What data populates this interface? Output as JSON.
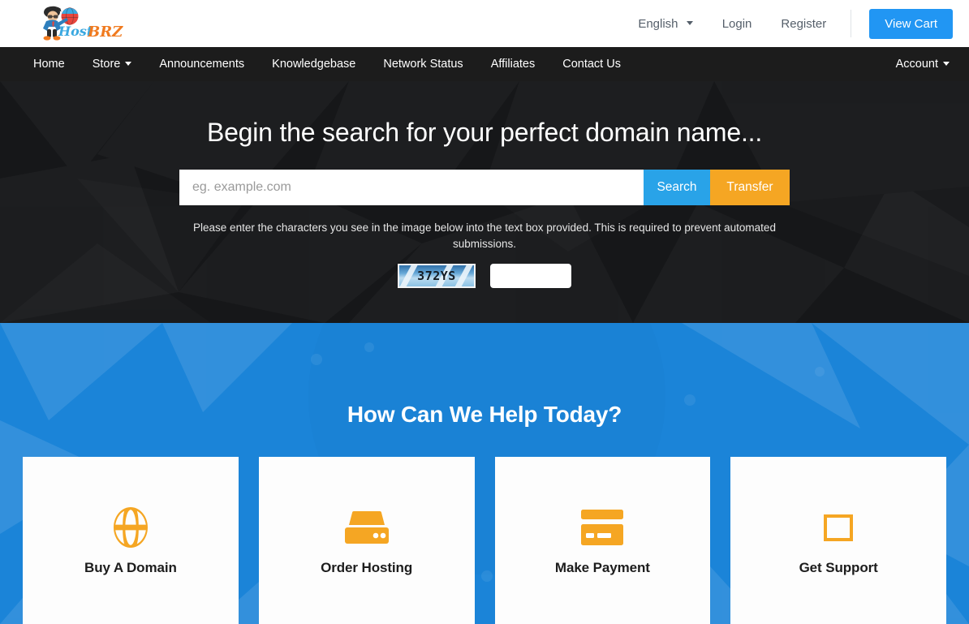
{
  "header": {
    "logo": {
      "name": "HostBRZ",
      "word1": "Host",
      "word2": "BRZ",
      "color1": "#3aa8e0",
      "color2": "#f07a1f"
    },
    "language": "English",
    "login": "Login",
    "register": "Register",
    "view_cart": "View Cart",
    "cart_color": "#2196f3"
  },
  "nav": {
    "items": [
      {
        "label": "Home",
        "caret": false
      },
      {
        "label": "Store",
        "caret": true
      },
      {
        "label": "Announcements",
        "caret": false
      },
      {
        "label": "Knowledgebase",
        "caret": false
      },
      {
        "label": "Network Status",
        "caret": false
      },
      {
        "label": "Affiliates",
        "caret": false
      },
      {
        "label": "Contact Us",
        "caret": false
      }
    ],
    "account": "Account",
    "background": "#1c1c1c"
  },
  "hero": {
    "title": "Begin the search for your perfect domain name...",
    "search_placeholder": "eg. example.com",
    "search_value": "",
    "search_button": "Search",
    "transfer_button": "Transfer",
    "search_color": "#29a3e8",
    "transfer_color": "#f5a623",
    "captcha_instructions": "Please enter the characters you see in the image below into the text box provided. This is required to prevent automated submissions.",
    "captcha_code": "372YS",
    "captcha_input_value": "",
    "background": "#161719"
  },
  "help": {
    "title": "How Can We Help Today?",
    "background": "#1b84d8",
    "icon_color": "#f5a623",
    "cards": [
      {
        "label": "Buy A Domain",
        "icon": "globe-icon"
      },
      {
        "label": "Order Hosting",
        "icon": "server-icon"
      },
      {
        "label": "Make Payment",
        "icon": "credit-card-icon"
      },
      {
        "label": "Get Support",
        "icon": "placeholder-square-icon"
      }
    ]
  }
}
